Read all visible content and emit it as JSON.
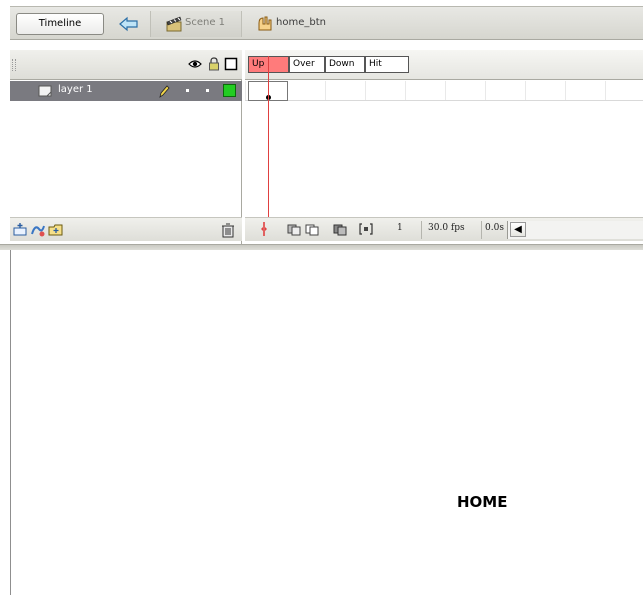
{
  "toolbar": {
    "timeline_label": "Timeline",
    "scene_label": "Scene 1",
    "symbol_label": "home_btn"
  },
  "layers": [
    {
      "name": "layer 1",
      "selected": true,
      "color": "#22cc22"
    }
  ],
  "frames": {
    "labels": [
      "Up",
      "Over",
      "Down",
      "Hit"
    ],
    "active": "Up"
  },
  "status": {
    "current_frame": "1",
    "frame_rate": "30.0 fps",
    "elapsed_time": "0.0s"
  },
  "stage": {
    "content_text": "HOME"
  },
  "colors": {
    "active_frame_label": "#ff7b7b",
    "playhead": "#e04040",
    "layer_selected_bg": "#7a7a80"
  }
}
